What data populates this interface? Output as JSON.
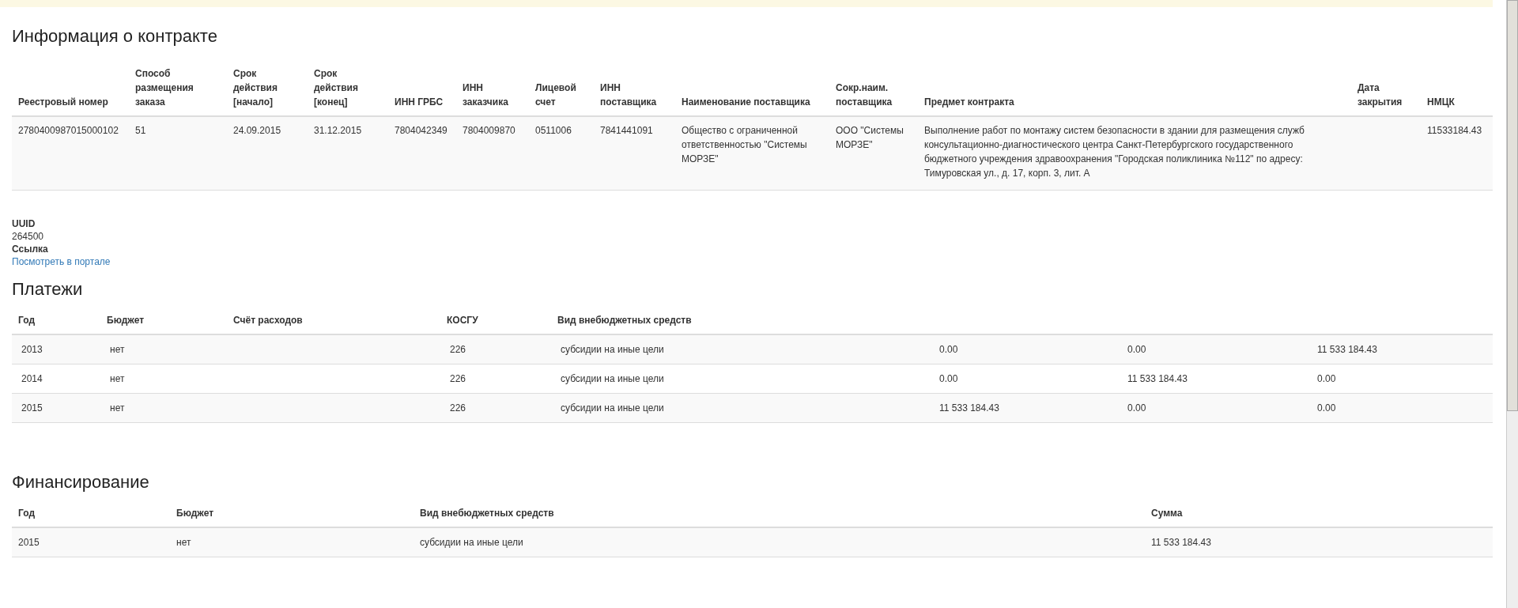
{
  "contract": {
    "title": "Информация о контракте",
    "columns": [
      "Реестровый номер",
      "Способ размещения заказа",
      "Срок действия [начало]",
      "Срок действия [конец]",
      "ИНН ГРБС",
      "ИНН заказчика",
      "Лицевой счет",
      "ИНН поставщика",
      "Наименование поставщика",
      "Сокр.наим. поставщика",
      "Предмет контракта",
      "Дата закрытия",
      "НМЦК"
    ],
    "rows": [
      [
        "2780400987015000102",
        "51",
        "24.09.2015",
        "31.12.2015",
        "7804042349",
        "7804009870",
        "0511006",
        "7841441091",
        "Общество с ограниченной ответственностью \"Системы МОРЗЕ\"",
        "ООО \"Системы МОРЗЕ\"",
        "Выполнение работ по монтажу систем безопасности в здании для размещения служб консультационно-диагностического центра Санкт-Петербургского государственного бюджетного учреждения здравоохранения \"Городская поликлиника №112\" по адресу: Тимуровская ул., д. 17, корп. 3, лит. А",
        "",
        "11533184.43"
      ]
    ]
  },
  "details": [
    {
      "label": "UUID",
      "value": "264500",
      "kind": "text"
    },
    {
      "label": "Ссылка",
      "value": "Посмотреть в портале",
      "kind": "link"
    }
  ],
  "payments": {
    "title": "Платежи",
    "columns": [
      "Год",
      "Бюджет",
      "Счёт расходов",
      "КОСГУ",
      "Вид внебюджетных средств",
      "",
      "",
      ""
    ],
    "rows": [
      [
        "2013",
        "нет",
        "",
        "226",
        "субсидии на иные цели",
        "0.00",
        "0.00",
        "11 533 184.43"
      ],
      [
        "2014",
        "нет",
        "",
        "226",
        "субсидии на иные цели",
        "0.00",
        "11 533 184.43",
        "0.00"
      ],
      [
        "2015",
        "нет",
        "",
        "226",
        "субсидии на иные цели",
        "11 533 184.43",
        "0.00",
        "0.00"
      ]
    ]
  },
  "financing": {
    "title": "Финансирование",
    "columns": [
      "Год",
      "Бюджет",
      "Вид внебюджетных средств",
      "Сумма"
    ],
    "rows": [
      [
        "2015",
        "нет",
        "субсидии на иные цели",
        "11 533 184.43"
      ]
    ]
  }
}
